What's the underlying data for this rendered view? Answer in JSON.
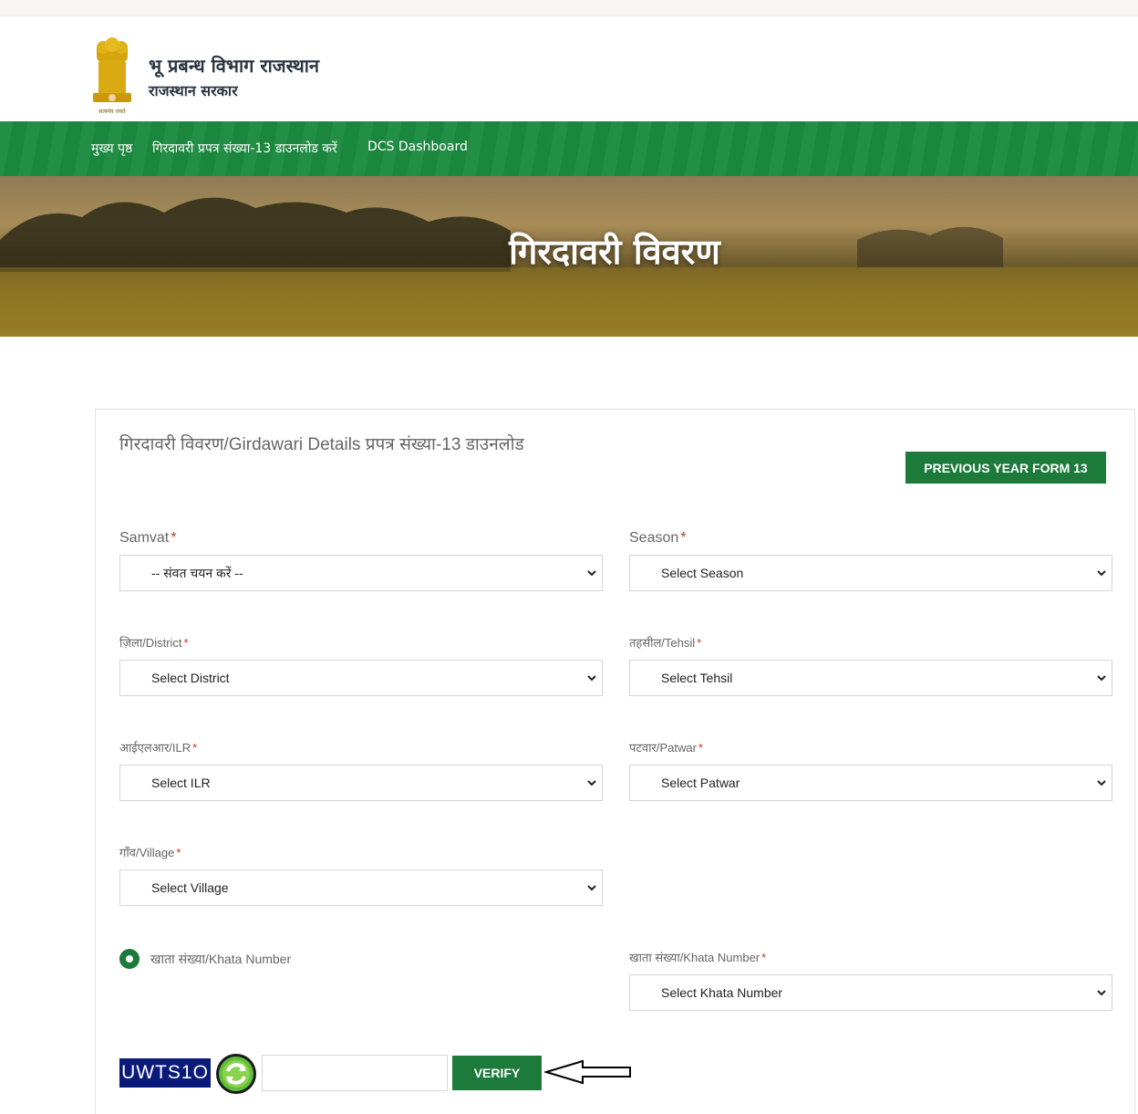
{
  "header": {
    "org_title": "भू प्रबन्ध विभाग राजस्थान",
    "org_subtitle": "राजस्थान सरकार",
    "emblem_caption": "सत्यमेव जयते"
  },
  "nav": {
    "items": [
      "मुख्य पृष्ठ",
      "गिरदावरी प्रपत्र संख्या-13 डाउनलोड करें",
      "DCS Dashboard"
    ]
  },
  "banner": {
    "title": "गिरदावरी विवरण"
  },
  "form": {
    "title": "गिरदावरी विवरण/Girdawari Details प्रपत्र संख्या-13 डाउनलोड",
    "prev_year_button": "PREVIOUS YEAR FORM 13",
    "required_mark": "*",
    "samvat": {
      "label": "Samvat",
      "value": "-- संवत चयन करें --"
    },
    "season": {
      "label": "Season",
      "value": "Select Season"
    },
    "district": {
      "label": "ज़िला/District",
      "value": "Select District"
    },
    "tehsil": {
      "label": "तहसील/Tehsil",
      "value": "Select Tehsil"
    },
    "ilr": {
      "label": "आईएलआर/ILR",
      "value": "Select ILR"
    },
    "patwar": {
      "label": "पटवार/Patwar",
      "value": "Select Patwar"
    },
    "village": {
      "label": "गाँव/Village",
      "value": "Select Village"
    },
    "khata_radio_label": "खाता संख्या/Khata Number",
    "khata": {
      "label": "खाता संख्या/Khata Number",
      "value": "Select Khata Number"
    },
    "captcha_text": "UWTS1O",
    "verify_button": "VERIFY"
  },
  "colors": {
    "primary_green": "#1c7a3a",
    "nav_green": "#1c8a3f",
    "captcha_bg": "#0a1a7a",
    "required": "#c0392b"
  },
  "icons": {
    "emblem": "national-emblem-icon",
    "refresh": "refresh-icon",
    "arrow": "left-arrow-icon",
    "dropdown": "chevron-down-icon"
  }
}
